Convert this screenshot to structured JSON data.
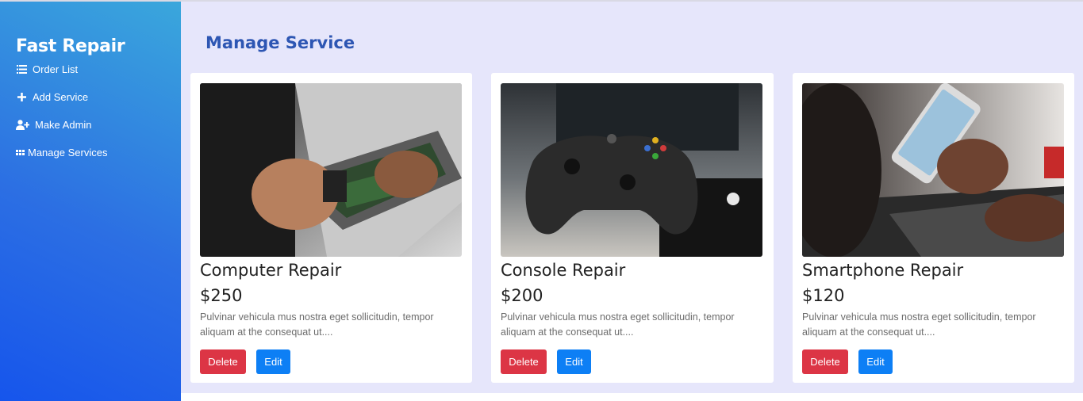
{
  "app": {
    "brand": "Fast Repair"
  },
  "sidebar": {
    "items": [
      {
        "label": "Order List",
        "icon": "list-icon"
      },
      {
        "label": "Add Service",
        "icon": "plus-icon"
      },
      {
        "label": "Make Admin",
        "icon": "user-plus-icon"
      },
      {
        "label": "Manage Services",
        "icon": "grid-icon"
      }
    ]
  },
  "main": {
    "title": "Manage Service",
    "cards": [
      {
        "title": "Computer Repair",
        "price": "$250",
        "description": "Pulvinar vehicula mus nostra eget sollicitudin, tempor aliquam at the consequat ut....",
        "delete_label": "Delete",
        "edit_label": "Edit"
      },
      {
        "title": "Console Repair",
        "price": "$200",
        "description": "Pulvinar vehicula mus nostra eget sollicitudin, tempor aliquam at the consequat ut....",
        "delete_label": "Delete",
        "edit_label": "Edit"
      },
      {
        "title": "Smartphone Repair",
        "price": "$120",
        "description": "Pulvinar vehicula mus nostra eget sollicitudin, tempor aliquam at the consequat ut....",
        "delete_label": "Delete",
        "edit_label": "Edit"
      }
    ]
  },
  "colors": {
    "sidebar_gradient": [
      "#3aa7dc",
      "#1655ec"
    ],
    "main_background": "#e6e6fb",
    "title": "#2d56b3",
    "delete": "#dc3545",
    "edit": "#0d7ff5"
  }
}
